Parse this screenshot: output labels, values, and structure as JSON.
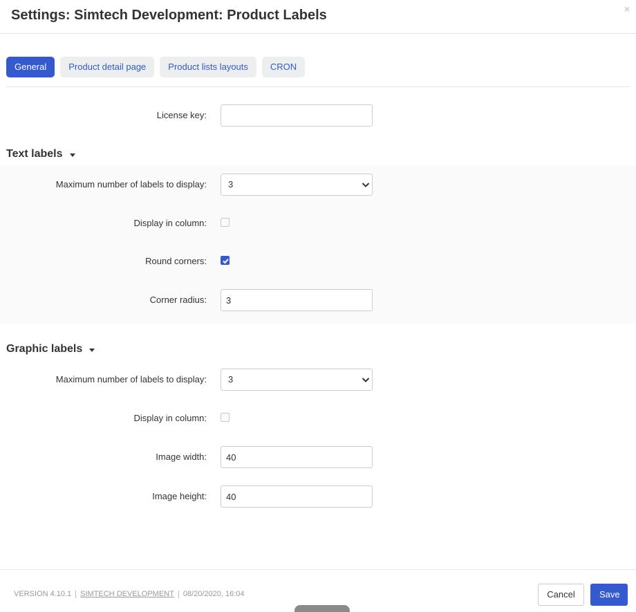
{
  "dialog": {
    "title": "Settings: Simtech Development: Product Labels",
    "close_glyph": "×"
  },
  "tabs": [
    {
      "label": "General",
      "active": true
    },
    {
      "label": "Product detail page",
      "active": false
    },
    {
      "label": "Product lists layouts",
      "active": false
    },
    {
      "label": "CRON",
      "active": false
    }
  ],
  "license": {
    "label": "License key:",
    "value": ""
  },
  "text_labels": {
    "title": "Text labels",
    "max_labels": {
      "label": "Maximum number of labels to display:",
      "value": "3"
    },
    "display_in_column": {
      "label": "Display in column:",
      "checked": false
    },
    "round_corners": {
      "label": "Round corners:",
      "checked": true
    },
    "corner_radius": {
      "label": "Corner radius:",
      "value": "3"
    }
  },
  "graphic_labels": {
    "title": "Graphic labels",
    "max_labels": {
      "label": "Maximum number of labels to display:",
      "value": "3"
    },
    "display_in_column": {
      "label": "Display in column:",
      "checked": false
    },
    "image_width": {
      "label": "Image width:",
      "value": "40"
    },
    "image_height": {
      "label": "Image height:",
      "value": "40"
    }
  },
  "footer": {
    "version": "VERSION 4.10.1",
    "developer": "SIMTECH DEVELOPMENT",
    "date": "08/20/2020, 16:04",
    "cancel_label": "Cancel",
    "save_label": "Save"
  },
  "colors": {
    "accent": "#3559cf",
    "tab_bg": "#eceef0",
    "section_bg": "#fafafa"
  }
}
